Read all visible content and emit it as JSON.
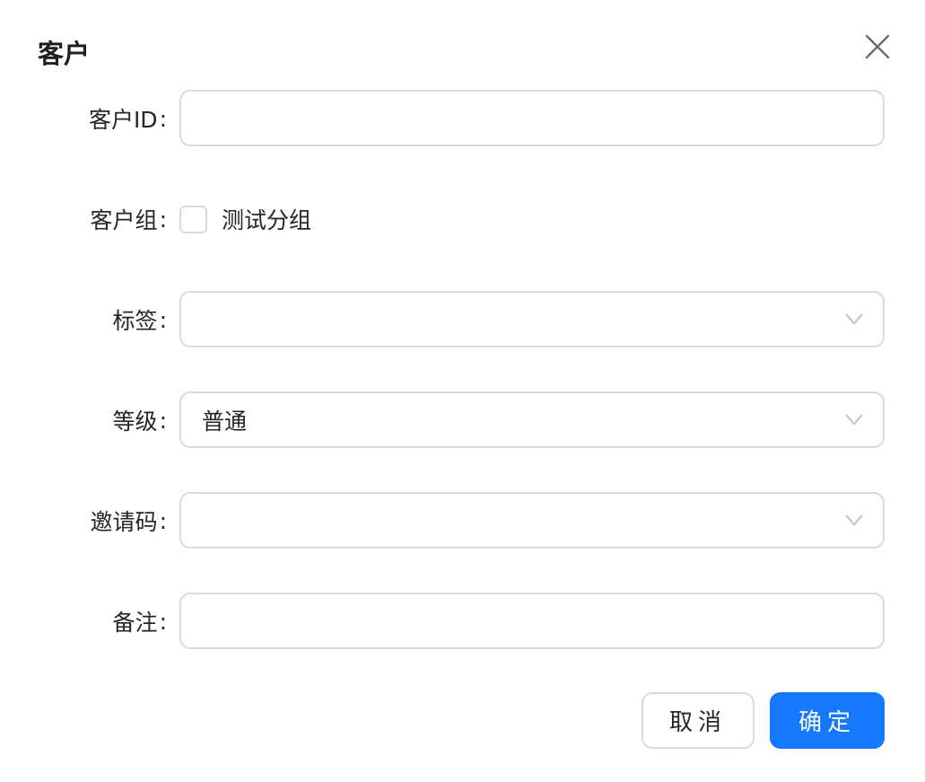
{
  "dialog": {
    "title": "客户",
    "close_icon": "close-icon"
  },
  "form": {
    "colon": ":",
    "customer_id": {
      "label": "客户ID",
      "value": ""
    },
    "customer_group": {
      "label": "客户组",
      "option_label": "测试分组",
      "checked": false
    },
    "tags": {
      "label": "标签",
      "value": ""
    },
    "level": {
      "label": "等级",
      "value": "普通"
    },
    "invite_code": {
      "label": "邀请码",
      "value": ""
    },
    "remark": {
      "label": "备注",
      "value": ""
    }
  },
  "footer": {
    "cancel_label": "取消",
    "ok_label": "确定"
  },
  "colors": {
    "primary": "#1677ff",
    "border": "#d9d9d9",
    "text": "#262626"
  }
}
